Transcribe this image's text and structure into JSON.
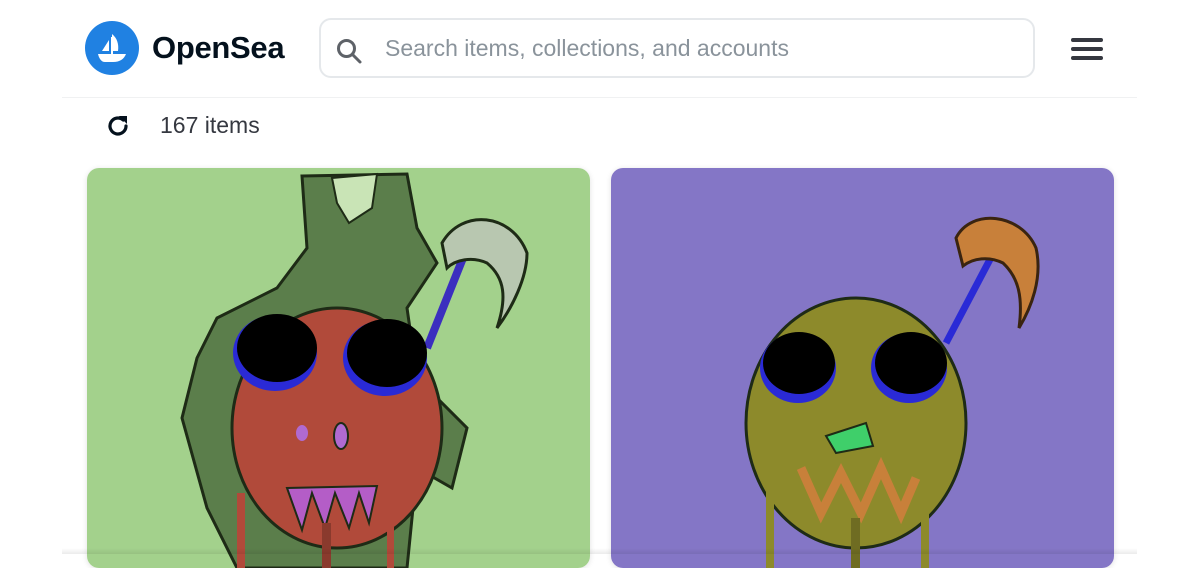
{
  "header": {
    "brand": "OpenSea",
    "logo_icon": "opensea-ship-icon",
    "brand_color": "#2081e2",
    "search": {
      "placeholder": "Search items, collections, and accounts",
      "value": "",
      "icon": "search-icon"
    },
    "menu_icon": "hamburger-menu-icon"
  },
  "toolbar": {
    "refresh_icon": "refresh-icon",
    "item_count": "167 items"
  },
  "grid": {
    "cards": [
      {
        "background": "#a3d18c",
        "image": "nft-skull-art-green"
      },
      {
        "background": "#8476c6",
        "image": "nft-skull-art-purple"
      }
    ]
  }
}
